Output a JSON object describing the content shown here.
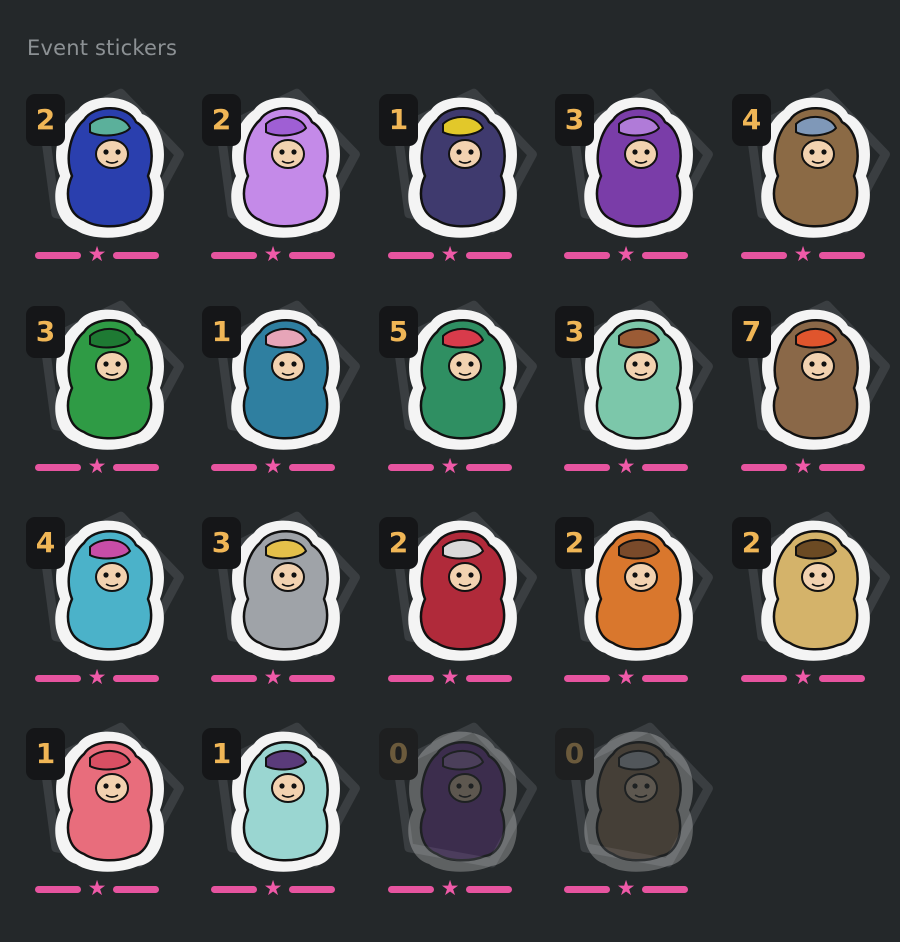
{
  "section": {
    "title": "Event stickers"
  },
  "stickers": [
    {
      "count": "2",
      "icon": "blue-hooded-witch-icon",
      "fill": "#2a3fae",
      "accent": "#5bb09b"
    },
    {
      "count": "2",
      "icon": "purple-genie-ghost-icon",
      "fill": "#c48ae8",
      "accent": "#9f5fd4"
    },
    {
      "count": "1",
      "icon": "axe-wielding-monster-icon",
      "fill": "#3f3a6e",
      "accent": "#e2c82a"
    },
    {
      "count": "3",
      "icon": "purple-bird-creature-icon",
      "fill": "#7a3da8",
      "accent": "#b07bd8"
    },
    {
      "count": "4",
      "icon": "armored-spear-goblin-icon",
      "fill": "#8b6a45",
      "accent": "#7f98b8"
    },
    {
      "count": "3",
      "icon": "green-slime-blob-icon",
      "fill": "#2f9b45",
      "accent": "#1e7a33"
    },
    {
      "count": "1",
      "icon": "pointed-hat-wizard-icon",
      "fill": "#2f7fa0",
      "accent": "#e7a5b8"
    },
    {
      "count": "5",
      "icon": "red-haired-witch-icon",
      "fill": "#2f8f62",
      "accent": "#d83b4b"
    },
    {
      "count": "3",
      "icon": "turtle-club-warrior-icon",
      "fill": "#7cc7aa",
      "accent": "#9b5b35"
    },
    {
      "count": "7",
      "icon": "red-haired-dwarf-icon",
      "fill": "#8a6848",
      "accent": "#e0552d"
    },
    {
      "count": "4",
      "icon": "bald-staff-wizard-icon",
      "fill": "#4bb2c9",
      "accent": "#c84da7"
    },
    {
      "count": "3",
      "icon": "blond-sword-knight-icon",
      "fill": "#9fa3a8",
      "accent": "#e4c04a"
    },
    {
      "count": "2",
      "icon": "red-haired-swordsman-icon",
      "fill": "#b02a3a",
      "accent": "#d9d9d9"
    },
    {
      "count": "2",
      "icon": "orange-haired-warrior-icon",
      "fill": "#d9772d",
      "accent": "#7a4a2a"
    },
    {
      "count": "2",
      "icon": "blond-gunner-girl-icon",
      "fill": "#d4b36a",
      "accent": "#6b4a23"
    },
    {
      "count": "1",
      "icon": "pink-haired-maiden-icon",
      "fill": "#e86d7c",
      "accent": "#d94f63"
    },
    {
      "count": "1",
      "icon": "teal-haired-fighter-icon",
      "fill": "#9ad6d1",
      "accent": "#5a3b7a"
    },
    {
      "count": "0",
      "icon": "purple-bird-creature-icon",
      "fill": "#7a3da8",
      "accent": "#b07bd8"
    },
    {
      "count": "0",
      "icon": "armored-cavalier-icon",
      "fill": "#9b7a5a",
      "accent": "#c7cfd8"
    }
  ],
  "colors": {
    "background": "#24282a",
    "rating_pink": "#e6549f",
    "count_text": "#f0b656"
  },
  "rating_icon": "star-icon"
}
